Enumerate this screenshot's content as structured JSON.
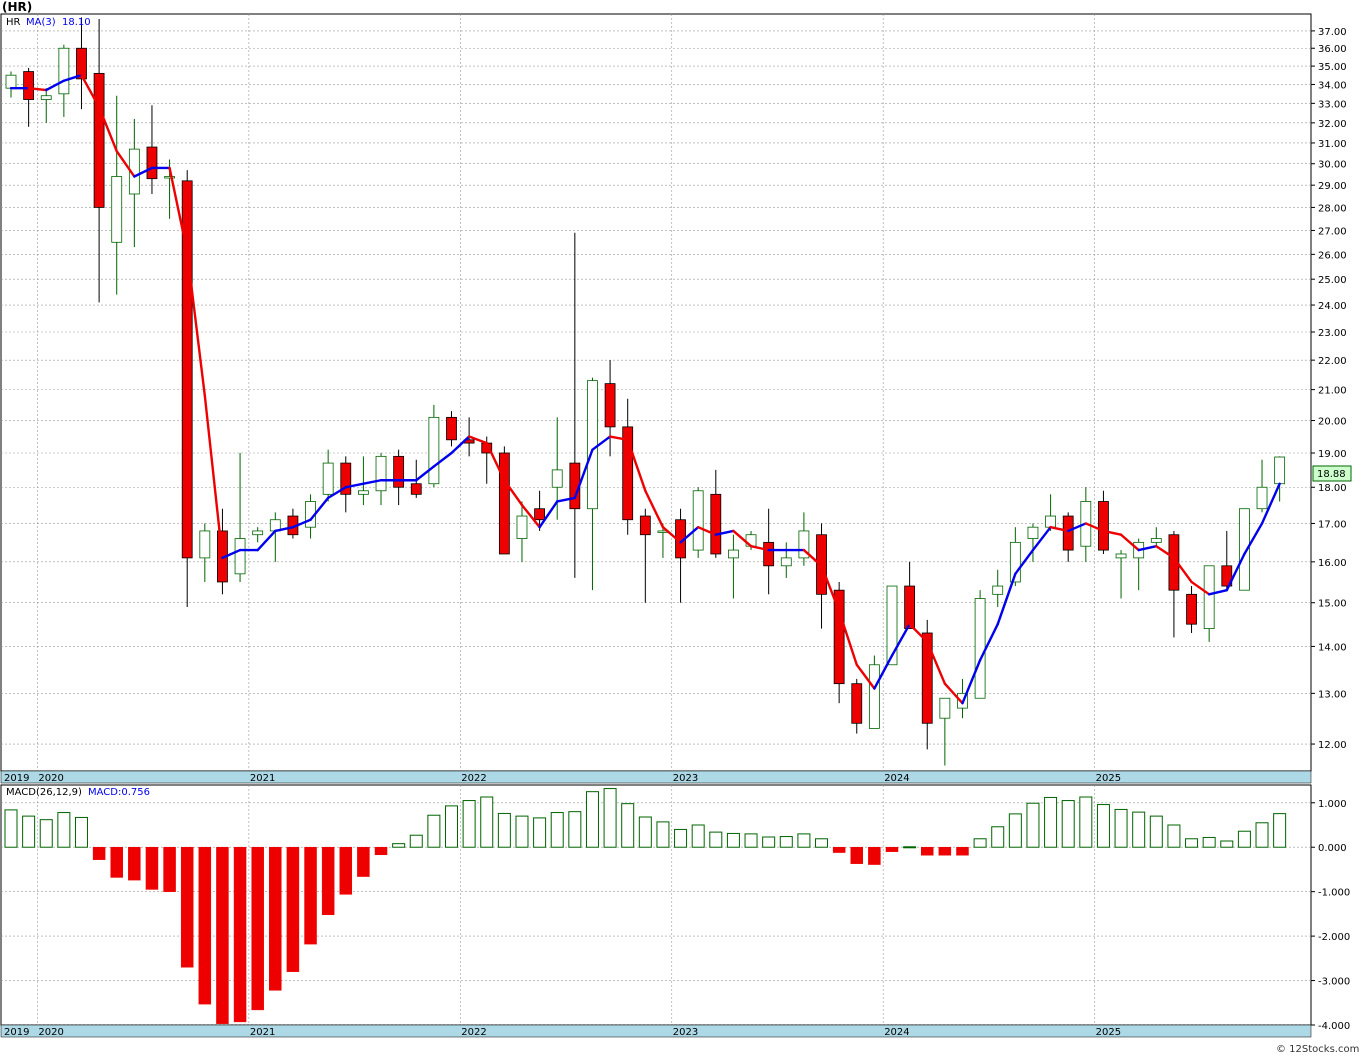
{
  "header": {
    "title": "(HR)",
    "symbol_label": "HR",
    "ma_label": "MA(3)",
    "ma_value": "18.10",
    "last_price": "18.88",
    "macd_label": "MACD(26,12,9)",
    "macd_value": "MACD:0.756",
    "footer": "© 12Stocks.com"
  },
  "colors": {
    "up_body": "#ffffff",
    "up_outline": "#006400",
    "down_body": "#ee0000",
    "ma_up": "#0000ee",
    "ma_down": "#ee0000",
    "macd_pos_outline": "#006400",
    "macd_neg_fill": "#ee0000",
    "grid": "#999999",
    "axis_band": "#add8e6",
    "last_price_box": "#ccffcc"
  },
  "chart_data": [
    {
      "type": "candlestick",
      "interval": "monthly",
      "start_month": "2019-11",
      "ylim": [
        11.5,
        38
      ],
      "price_ticks": [
        12,
        13,
        14,
        15,
        16,
        17,
        18,
        19,
        20,
        21,
        22,
        23,
        24,
        25,
        26,
        27,
        28,
        29,
        30,
        31,
        32,
        33,
        34,
        35,
        36,
        37
      ],
      "year_labels": [
        {
          "label": "2019",
          "index": 0
        },
        {
          "label": "2020",
          "index": 2
        },
        {
          "label": "2021",
          "index": 14
        },
        {
          "label": "2022",
          "index": 26
        },
        {
          "label": "2023",
          "index": 38
        },
        {
          "label": "2024",
          "index": 50
        },
        {
          "label": "2025",
          "index": 62
        }
      ],
      "candles": [
        {
          "o": 33.8,
          "h": 34.7,
          "l": 33.3,
          "c": 34.5
        },
        {
          "o": 34.7,
          "h": 34.9,
          "l": 31.8,
          "c": 33.2
        },
        {
          "o": 33.2,
          "h": 33.8,
          "l": 32.0,
          "c": 33.4
        },
        {
          "o": 33.5,
          "h": 36.2,
          "l": 32.3,
          "c": 36.0
        },
        {
          "o": 36.0,
          "h": 37.8,
          "l": 32.7,
          "c": 34.3
        },
        {
          "o": 34.6,
          "h": 37.7,
          "l": 24.1,
          "c": 28.0
        },
        {
          "o": 26.5,
          "h": 33.4,
          "l": 24.4,
          "c": 29.4
        },
        {
          "o": 28.6,
          "h": 32.2,
          "l": 26.3,
          "c": 30.7
        },
        {
          "o": 30.8,
          "h": 32.9,
          "l": 28.6,
          "c": 29.3
        },
        {
          "o": 29.4,
          "h": 30.2,
          "l": 27.5,
          "c": 29.4
        },
        {
          "o": 29.2,
          "h": 29.7,
          "l": 14.9,
          "c": 16.1
        },
        {
          "o": 16.1,
          "h": 17.0,
          "l": 15.5,
          "c": 16.8
        },
        {
          "o": 16.8,
          "h": 17.4,
          "l": 15.2,
          "c": 15.5
        },
        {
          "o": 15.7,
          "h": 19.0,
          "l": 15.5,
          "c": 16.6
        },
        {
          "o": 16.7,
          "h": 16.9,
          "l": 16.5,
          "c": 16.8
        },
        {
          "o": 16.8,
          "h": 17.3,
          "l": 16.0,
          "c": 17.1
        },
        {
          "o": 17.2,
          "h": 17.4,
          "l": 16.6,
          "c": 16.7
        },
        {
          "o": 16.9,
          "h": 17.8,
          "l": 16.6,
          "c": 17.6
        },
        {
          "o": 17.8,
          "h": 19.1,
          "l": 17.6,
          "c": 18.7
        },
        {
          "o": 18.7,
          "h": 18.9,
          "l": 17.3,
          "c": 17.8
        },
        {
          "o": 17.8,
          "h": 18.9,
          "l": 17.5,
          "c": 17.9
        },
        {
          "o": 17.9,
          "h": 19.0,
          "l": 17.5,
          "c": 18.9
        },
        {
          "o": 18.9,
          "h": 19.1,
          "l": 17.5,
          "c": 18.0
        },
        {
          "o": 18.1,
          "h": 18.8,
          "l": 17.7,
          "c": 17.8
        },
        {
          "o": 18.1,
          "h": 20.5,
          "l": 18.0,
          "c": 20.1
        },
        {
          "o": 20.1,
          "h": 20.3,
          "l": 19.2,
          "c": 19.4
        },
        {
          "o": 19.4,
          "h": 20.1,
          "l": 18.9,
          "c": 19.3
        },
        {
          "o": 19.3,
          "h": 19.5,
          "l": 18.1,
          "c": 19.0
        },
        {
          "o": 19.0,
          "h": 19.2,
          "l": 16.2,
          "c": 16.2
        },
        {
          "o": 16.6,
          "h": 17.6,
          "l": 16.0,
          "c": 17.2
        },
        {
          "o": 17.4,
          "h": 17.9,
          "l": 16.8,
          "c": 17.1
        },
        {
          "o": 18.0,
          "h": 20.1,
          "l": 17.1,
          "c": 18.5
        },
        {
          "o": 18.7,
          "h": 26.9,
          "l": 15.6,
          "c": 17.4
        },
        {
          "o": 17.4,
          "h": 21.4,
          "l": 15.3,
          "c": 21.3
        },
        {
          "o": 21.2,
          "h": 22.0,
          "l": 18.9,
          "c": 19.8
        },
        {
          "o": 19.8,
          "h": 20.7,
          "l": 16.7,
          "c": 17.1
        },
        {
          "o": 17.2,
          "h": 17.4,
          "l": 15.0,
          "c": 16.7
        },
        {
          "o": 16.8,
          "h": 17.0,
          "l": 16.1,
          "c": 16.8
        },
        {
          "o": 17.1,
          "h": 17.4,
          "l": 15.0,
          "c": 16.1
        },
        {
          "o": 16.3,
          "h": 18.0,
          "l": 16.1,
          "c": 17.9
        },
        {
          "o": 17.8,
          "h": 18.5,
          "l": 16.1,
          "c": 16.2
        },
        {
          "o": 16.1,
          "h": 16.7,
          "l": 15.1,
          "c": 16.3
        },
        {
          "o": 16.4,
          "h": 16.8,
          "l": 16.3,
          "c": 16.7
        },
        {
          "o": 16.5,
          "h": 17.4,
          "l": 15.2,
          "c": 15.9
        },
        {
          "o": 15.9,
          "h": 16.5,
          "l": 15.6,
          "c": 16.1
        },
        {
          "o": 16.1,
          "h": 17.3,
          "l": 15.9,
          "c": 16.8
        },
        {
          "o": 16.7,
          "h": 17.0,
          "l": 14.4,
          "c": 15.2
        },
        {
          "o": 15.3,
          "h": 15.5,
          "l": 12.8,
          "c": 13.2
        },
        {
          "o": 13.2,
          "h": 13.3,
          "l": 12.2,
          "c": 12.4
        },
        {
          "o": 12.3,
          "h": 13.8,
          "l": 12.3,
          "c": 13.6
        },
        {
          "o": 13.6,
          "h": 15.4,
          "l": 13.6,
          "c": 15.4
        },
        {
          "o": 15.4,
          "h": 16.0,
          "l": 14.4,
          "c": 14.4
        },
        {
          "o": 14.3,
          "h": 14.6,
          "l": 11.9,
          "c": 12.4
        },
        {
          "o": 12.5,
          "h": 12.9,
          "l": 11.6,
          "c": 12.9
        },
        {
          "o": 12.7,
          "h": 13.3,
          "l": 12.5,
          "c": 13.0
        },
        {
          "o": 12.9,
          "h": 15.3,
          "l": 12.9,
          "c": 15.1
        },
        {
          "o": 15.2,
          "h": 15.8,
          "l": 14.9,
          "c": 15.4
        },
        {
          "o": 15.5,
          "h": 16.9,
          "l": 15.4,
          "c": 16.5
        },
        {
          "o": 16.6,
          "h": 17.0,
          "l": 16.0,
          "c": 16.9
        },
        {
          "o": 16.9,
          "h": 17.8,
          "l": 16.8,
          "c": 17.2
        },
        {
          "o": 17.2,
          "h": 17.3,
          "l": 16.0,
          "c": 16.3
        },
        {
          "o": 16.4,
          "h": 18.0,
          "l": 16.0,
          "c": 17.6
        },
        {
          "o": 17.6,
          "h": 17.9,
          "l": 16.2,
          "c": 16.3
        },
        {
          "o": 16.1,
          "h": 16.3,
          "l": 15.1,
          "c": 16.2
        },
        {
          "o": 16.1,
          "h": 16.6,
          "l": 15.3,
          "c": 16.5
        },
        {
          "o": 16.5,
          "h": 16.9,
          "l": 16.4,
          "c": 16.6
        },
        {
          "o": 16.7,
          "h": 16.8,
          "l": 14.2,
          "c": 15.3
        },
        {
          "o": 15.2,
          "h": 15.4,
          "l": 14.3,
          "c": 14.5
        },
        {
          "o": 14.4,
          "h": 15.9,
          "l": 14.1,
          "c": 15.9
        },
        {
          "o": 15.9,
          "h": 16.8,
          "l": 15.3,
          "c": 15.4
        },
        {
          "o": 15.3,
          "h": 17.4,
          "l": 15.3,
          "c": 17.4
        },
        {
          "o": 17.4,
          "h": 18.8,
          "l": 17.3,
          "c": 18.0
        },
        {
          "o": 18.1,
          "h": 18.9,
          "l": 17.6,
          "c": 18.88
        }
      ],
      "ma3": [
        33.8,
        33.8,
        33.7,
        34.2,
        34.5,
        32.8,
        30.6,
        29.4,
        29.8,
        29.8,
        26.1,
        20.8,
        16.1,
        16.3,
        16.3,
        16.8,
        16.9,
        17.1,
        17.7,
        18.0,
        18.1,
        18.2,
        18.2,
        18.2,
        18.6,
        19.0,
        19.5,
        19.3,
        18.2,
        17.5,
        16.9,
        17.6,
        17.7,
        19.1,
        19.5,
        19.4,
        17.9,
        16.9,
        16.5,
        16.9,
        16.7,
        16.8,
        16.4,
        16.3,
        16.3,
        16.3,
        15.9,
        14.8,
        13.6,
        13.1,
        13.8,
        14.5,
        14.1,
        13.2,
        12.8,
        13.7,
        14.5,
        15.7,
        16.3,
        16.9,
        16.8,
        17.0,
        16.8,
        16.7,
        16.3,
        16.4,
        16.1,
        15.5,
        15.2,
        15.3,
        16.2,
        17.0,
        18.1
      ],
      "last_price": 18.88
    },
    {
      "type": "bar",
      "title": "MACD(26,12,9)",
      "ylim": [
        -4.0,
        1.4
      ],
      "y_ticks": [
        1.0,
        0.0,
        -1.0,
        -2.0,
        -3.0,
        -4.0
      ],
      "y_tick_labels": [
        "1.000",
        "0.000",
        "-1.000",
        "-2.000",
        "-3.000",
        "-4.000"
      ],
      "values": [
        0.84,
        0.7,
        0.62,
        0.78,
        0.67,
        -0.28,
        -0.68,
        -0.74,
        -0.95,
        -1.0,
        -2.7,
        -3.53,
        -3.97,
        -3.93,
        -3.66,
        -3.22,
        -2.8,
        -2.18,
        -1.52,
        -1.06,
        -0.66,
        -0.17,
        0.08,
        0.27,
        0.72,
        0.93,
        1.05,
        1.13,
        0.76,
        0.7,
        0.66,
        0.78,
        0.8,
        1.25,
        1.32,
        0.98,
        0.68,
        0.57,
        0.4,
        0.5,
        0.34,
        0.31,
        0.3,
        0.23,
        0.24,
        0.3,
        0.19,
        -0.12,
        -0.37,
        -0.39,
        -0.1,
        0.01,
        -0.18,
        -0.18,
        -0.18,
        0.19,
        0.46,
        0.75,
        0.99,
        1.12,
        1.05,
        1.13,
        0.96,
        0.85,
        0.79,
        0.7,
        0.5,
        0.19,
        0.22,
        0.14,
        0.36,
        0.55,
        0.756
      ],
      "last_value": 0.756
    }
  ]
}
